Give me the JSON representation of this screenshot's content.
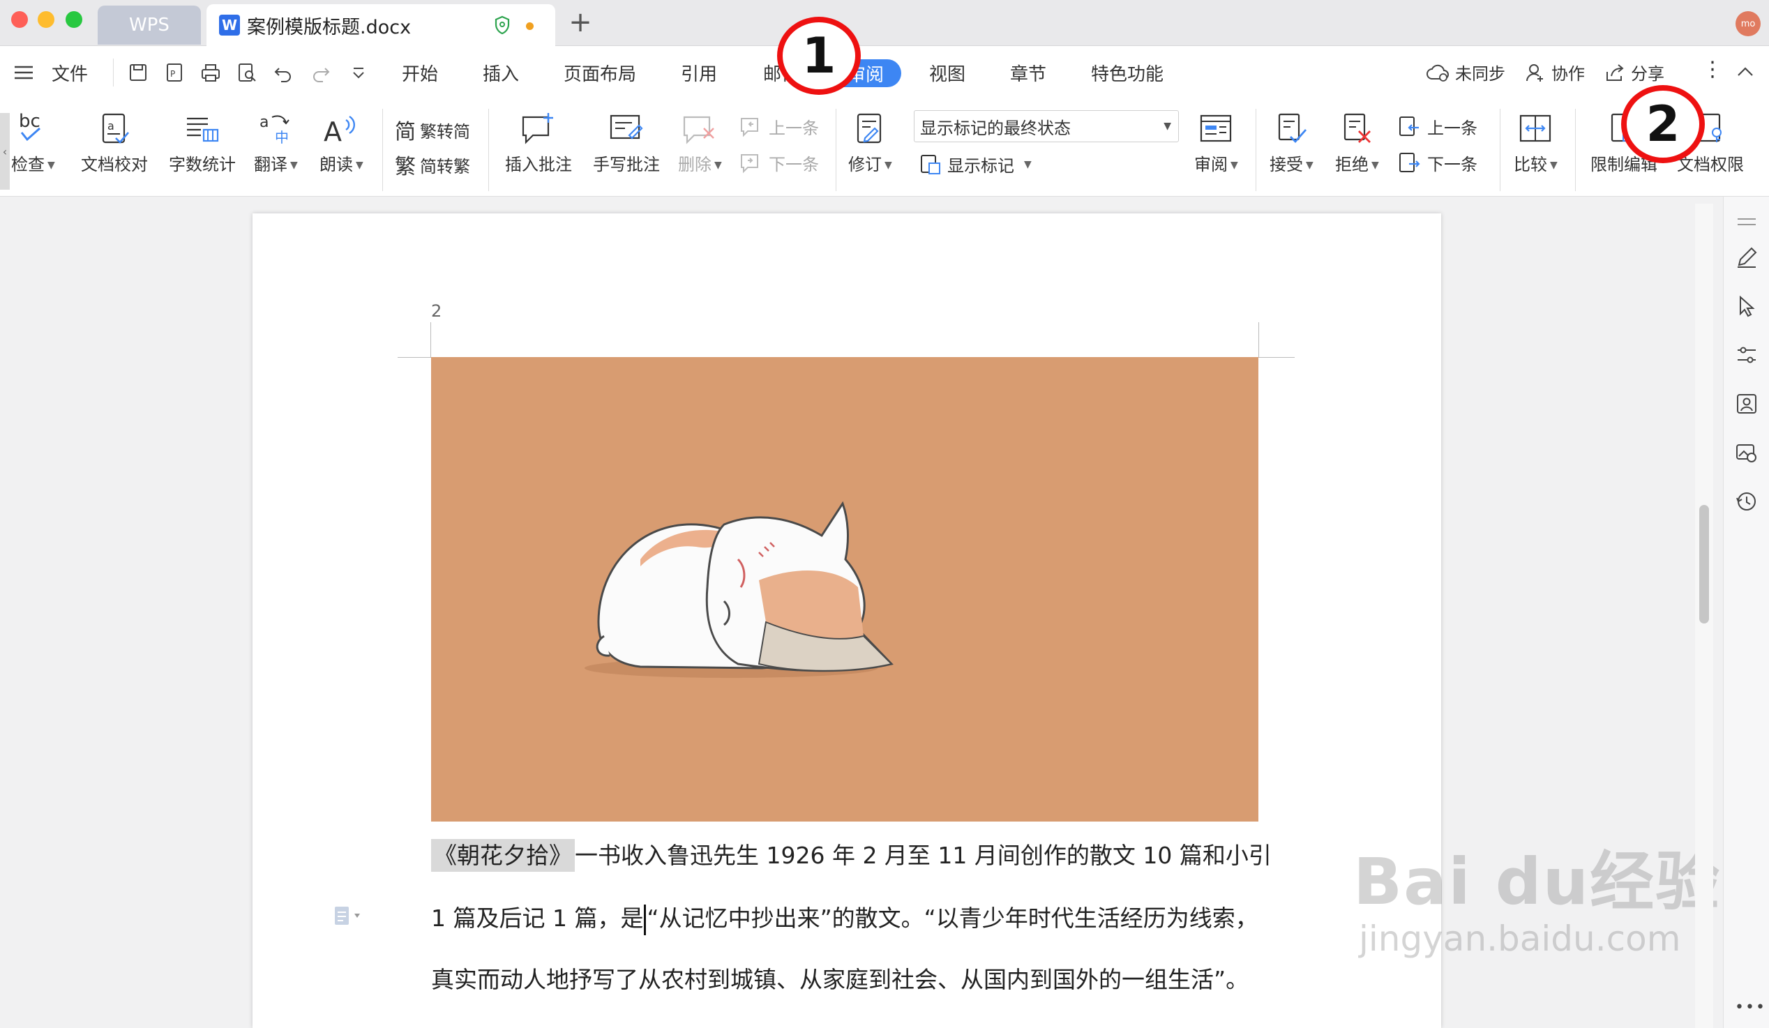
{
  "titlebar": {
    "app_tab": "WPS",
    "doc_tab": "案例模版标题.docx",
    "avatar_text": "mo"
  },
  "menubar": {
    "menu_label": "文件",
    "tabs": [
      "开始",
      "插入",
      "页面布局",
      "引用",
      "邮件",
      "审阅",
      "视图",
      "章节",
      "特色功能"
    ],
    "active_tab": "审阅",
    "right": {
      "sync": "未同步",
      "collab": "协作",
      "share": "分享"
    }
  },
  "ribbon": {
    "check": "检查",
    "proofread": "文档校对",
    "wordcount": "字数统计",
    "translate": "翻译",
    "readaloud": "朗读",
    "trad_to_simp": "繁转简",
    "simp_to_trad": "简转繁",
    "insert_comment": "插入批注",
    "handwrite_comment": "手写批注",
    "delete": "删除",
    "prev_comment": "上一条",
    "next_comment": "下一条",
    "track_changes": "修订",
    "markup_select": "显示标记的最终状态",
    "show_markup": "显示标记",
    "review": "审阅",
    "accept": "接受",
    "reject": "拒绝",
    "prev_change": "上一条",
    "next_change": "下一条",
    "compare": "比较",
    "restrict_edit": "限制编辑",
    "doc_permission": "文档权限"
  },
  "annotations": {
    "one": "1",
    "two": "2"
  },
  "document": {
    "page_number": "2",
    "line1_highlight": "《朝花夕拾》",
    "line1_rest": "一书收入鲁迅先生 1926 年 2 月至 11 月间创作的散文 10 篇和小引",
    "line2_before_cursor": "1 篇及后记 1 篇，是",
    "line2_after_cursor": "“从记忆中抄出来”的散文。“以青少年时代生活经历为线索，",
    "line3": "真实而动人地抒写了从农村到城镇、从家庭到社会、从国内到国外的一组生活”。"
  },
  "watermark": {
    "brand": "Bai du经验",
    "url": "jingyan.baidu.com"
  },
  "colors": {
    "accent": "#3d86f3",
    "annotation_ring": "#ee1111",
    "image_bg": "#d89c71"
  }
}
